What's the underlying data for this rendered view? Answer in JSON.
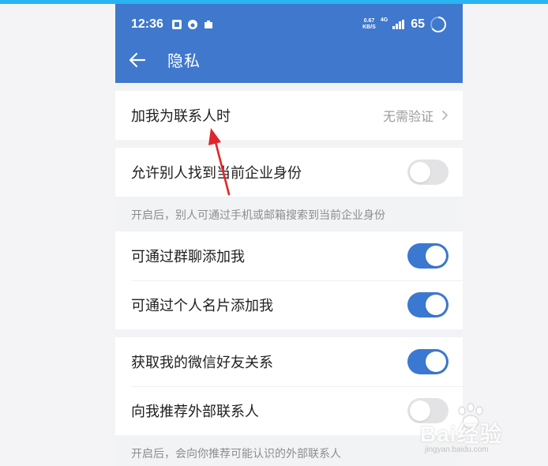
{
  "status_bar": {
    "time": "12:36",
    "left_icons": [
      "app-icon-1",
      "app-icon-2",
      "app-icon-3"
    ],
    "net_speed_value": "0.67",
    "net_speed_unit": "KB/S",
    "network_type": "4G",
    "battery": "65"
  },
  "header": {
    "title": "隐私",
    "back_icon": "arrow-left-icon",
    "background": "#3f78cc"
  },
  "settings": {
    "add_me": {
      "label": "加我为联系人时",
      "value": "无需验证"
    },
    "find_identity": {
      "label": "允许别人找到当前企业身份",
      "enabled": false,
      "hint": "开启后，别人可通过手机或邮箱搜索到当前企业身份"
    },
    "group_chat_add": {
      "label": "可通过群聊添加我",
      "enabled": true
    },
    "card_add": {
      "label": "可通过个人名片添加我",
      "enabled": true
    },
    "wechat_friends": {
      "label": "获取我的微信好友关系",
      "enabled": true
    },
    "recommend_external": {
      "label": "向我推荐外部联系人",
      "enabled": false,
      "hint": "开启后，会向你推荐可能认识的外部联系人"
    }
  },
  "colors": {
    "toggle_on": "#3b78d2",
    "toggle_off": "#e3e3e6",
    "annotation_arrow": "#e0262a",
    "accent_strip": "#29b4f2"
  },
  "watermark": {
    "logo_text": "Bai经验",
    "url": "jingyan.baidu.com"
  }
}
